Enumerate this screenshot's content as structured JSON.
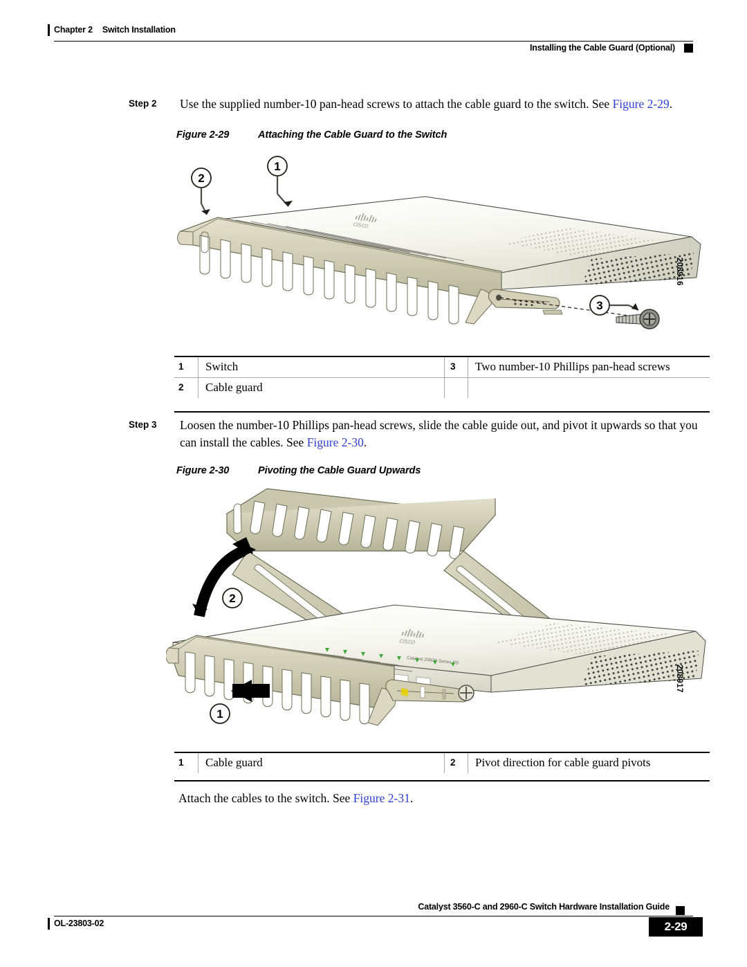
{
  "header": {
    "chapter": "Chapter 2",
    "chapter_title": "Switch Installation",
    "section_title": "Installing the Cable Guard (Optional)"
  },
  "steps": [
    {
      "label": "Step 2",
      "text_before": "Use the supplied number-10 pan-head screws to attach the cable guard to the switch. See ",
      "link": "Figure 2-29",
      "text_after": "."
    },
    {
      "label": "Step 3",
      "text_before": "Loosen the number-10 Phillips pan-head screws, slide the cable guide out, and pivot it upwards so that you can install the cables. See ",
      "link": "Figure 2-30",
      "text_after": "."
    }
  ],
  "figures": [
    {
      "number": "Figure 2-29",
      "title": "Attaching the Cable Guard to the Switch",
      "art_id": "208916",
      "callouts": [
        "1",
        "2",
        "3"
      ],
      "legend": [
        {
          "num": "1",
          "text": "Switch"
        },
        {
          "num": "3",
          "text": "Two number-10 Phillips pan-head screws"
        },
        {
          "num": "2",
          "text": "Cable guard"
        },
        {
          "num": "",
          "text": ""
        }
      ]
    },
    {
      "number": "Figure 2-30",
      "title": "Pivoting the Cable Guard Upwards",
      "art_id": "208917",
      "callouts": [
        "1",
        "2"
      ],
      "legend": [
        {
          "num": "1",
          "text": "Cable guard"
        },
        {
          "num": "2",
          "text": "Pivot direction for cable guard pivots"
        }
      ]
    }
  ],
  "closing_paragraph": {
    "text_before": "Attach the cables to the switch. See ",
    "link": "Figure 2-31",
    "text_after": "."
  },
  "device": {
    "brand_logo": "cisco",
    "model_label": "Catalyst 2960C Series PD"
  },
  "footer": {
    "doc_id": "OL-23803-02",
    "guide_title": "Catalyst 3560-C and 2960-C Switch Hardware Installation Guide",
    "page_number": "2-29"
  },
  "colors": {
    "link": "#2e3fd6",
    "chassis_light": "#f4f4ee",
    "chassis_mid": "#dcdcd0",
    "guard_body": "#cfcdb4",
    "guard_shade": "#b8b69a",
    "led_green": "#3ea832",
    "accent_yellow": "#e8d200",
    "ink": "#000000"
  }
}
